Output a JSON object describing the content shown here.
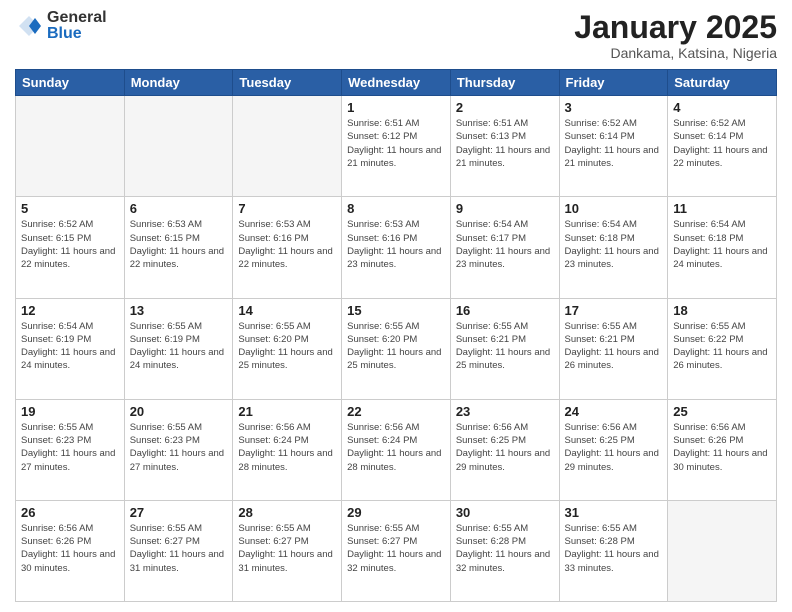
{
  "header": {
    "logo_general": "General",
    "logo_blue": "Blue",
    "month_title": "January 2025",
    "location": "Dankama, Katsina, Nigeria"
  },
  "days_of_week": [
    "Sunday",
    "Monday",
    "Tuesday",
    "Wednesday",
    "Thursday",
    "Friday",
    "Saturday"
  ],
  "weeks": [
    [
      {
        "day": "",
        "info": ""
      },
      {
        "day": "",
        "info": ""
      },
      {
        "day": "",
        "info": ""
      },
      {
        "day": "1",
        "info": "Sunrise: 6:51 AM\nSunset: 6:12 PM\nDaylight: 11 hours and 21 minutes."
      },
      {
        "day": "2",
        "info": "Sunrise: 6:51 AM\nSunset: 6:13 PM\nDaylight: 11 hours and 21 minutes."
      },
      {
        "day": "3",
        "info": "Sunrise: 6:52 AM\nSunset: 6:14 PM\nDaylight: 11 hours and 21 minutes."
      },
      {
        "day": "4",
        "info": "Sunrise: 6:52 AM\nSunset: 6:14 PM\nDaylight: 11 hours and 22 minutes."
      }
    ],
    [
      {
        "day": "5",
        "info": "Sunrise: 6:52 AM\nSunset: 6:15 PM\nDaylight: 11 hours and 22 minutes."
      },
      {
        "day": "6",
        "info": "Sunrise: 6:53 AM\nSunset: 6:15 PM\nDaylight: 11 hours and 22 minutes."
      },
      {
        "day": "7",
        "info": "Sunrise: 6:53 AM\nSunset: 6:16 PM\nDaylight: 11 hours and 22 minutes."
      },
      {
        "day": "8",
        "info": "Sunrise: 6:53 AM\nSunset: 6:16 PM\nDaylight: 11 hours and 23 minutes."
      },
      {
        "day": "9",
        "info": "Sunrise: 6:54 AM\nSunset: 6:17 PM\nDaylight: 11 hours and 23 minutes."
      },
      {
        "day": "10",
        "info": "Sunrise: 6:54 AM\nSunset: 6:18 PM\nDaylight: 11 hours and 23 minutes."
      },
      {
        "day": "11",
        "info": "Sunrise: 6:54 AM\nSunset: 6:18 PM\nDaylight: 11 hours and 24 minutes."
      }
    ],
    [
      {
        "day": "12",
        "info": "Sunrise: 6:54 AM\nSunset: 6:19 PM\nDaylight: 11 hours and 24 minutes."
      },
      {
        "day": "13",
        "info": "Sunrise: 6:55 AM\nSunset: 6:19 PM\nDaylight: 11 hours and 24 minutes."
      },
      {
        "day": "14",
        "info": "Sunrise: 6:55 AM\nSunset: 6:20 PM\nDaylight: 11 hours and 25 minutes."
      },
      {
        "day": "15",
        "info": "Sunrise: 6:55 AM\nSunset: 6:20 PM\nDaylight: 11 hours and 25 minutes."
      },
      {
        "day": "16",
        "info": "Sunrise: 6:55 AM\nSunset: 6:21 PM\nDaylight: 11 hours and 25 minutes."
      },
      {
        "day": "17",
        "info": "Sunrise: 6:55 AM\nSunset: 6:21 PM\nDaylight: 11 hours and 26 minutes."
      },
      {
        "day": "18",
        "info": "Sunrise: 6:55 AM\nSunset: 6:22 PM\nDaylight: 11 hours and 26 minutes."
      }
    ],
    [
      {
        "day": "19",
        "info": "Sunrise: 6:55 AM\nSunset: 6:23 PM\nDaylight: 11 hours and 27 minutes."
      },
      {
        "day": "20",
        "info": "Sunrise: 6:55 AM\nSunset: 6:23 PM\nDaylight: 11 hours and 27 minutes."
      },
      {
        "day": "21",
        "info": "Sunrise: 6:56 AM\nSunset: 6:24 PM\nDaylight: 11 hours and 28 minutes."
      },
      {
        "day": "22",
        "info": "Sunrise: 6:56 AM\nSunset: 6:24 PM\nDaylight: 11 hours and 28 minutes."
      },
      {
        "day": "23",
        "info": "Sunrise: 6:56 AM\nSunset: 6:25 PM\nDaylight: 11 hours and 29 minutes."
      },
      {
        "day": "24",
        "info": "Sunrise: 6:56 AM\nSunset: 6:25 PM\nDaylight: 11 hours and 29 minutes."
      },
      {
        "day": "25",
        "info": "Sunrise: 6:56 AM\nSunset: 6:26 PM\nDaylight: 11 hours and 30 minutes."
      }
    ],
    [
      {
        "day": "26",
        "info": "Sunrise: 6:56 AM\nSunset: 6:26 PM\nDaylight: 11 hours and 30 minutes."
      },
      {
        "day": "27",
        "info": "Sunrise: 6:55 AM\nSunset: 6:27 PM\nDaylight: 11 hours and 31 minutes."
      },
      {
        "day": "28",
        "info": "Sunrise: 6:55 AM\nSunset: 6:27 PM\nDaylight: 11 hours and 31 minutes."
      },
      {
        "day": "29",
        "info": "Sunrise: 6:55 AM\nSunset: 6:27 PM\nDaylight: 11 hours and 32 minutes."
      },
      {
        "day": "30",
        "info": "Sunrise: 6:55 AM\nSunset: 6:28 PM\nDaylight: 11 hours and 32 minutes."
      },
      {
        "day": "31",
        "info": "Sunrise: 6:55 AM\nSunset: 6:28 PM\nDaylight: 11 hours and 33 minutes."
      },
      {
        "day": "",
        "info": ""
      }
    ]
  ]
}
